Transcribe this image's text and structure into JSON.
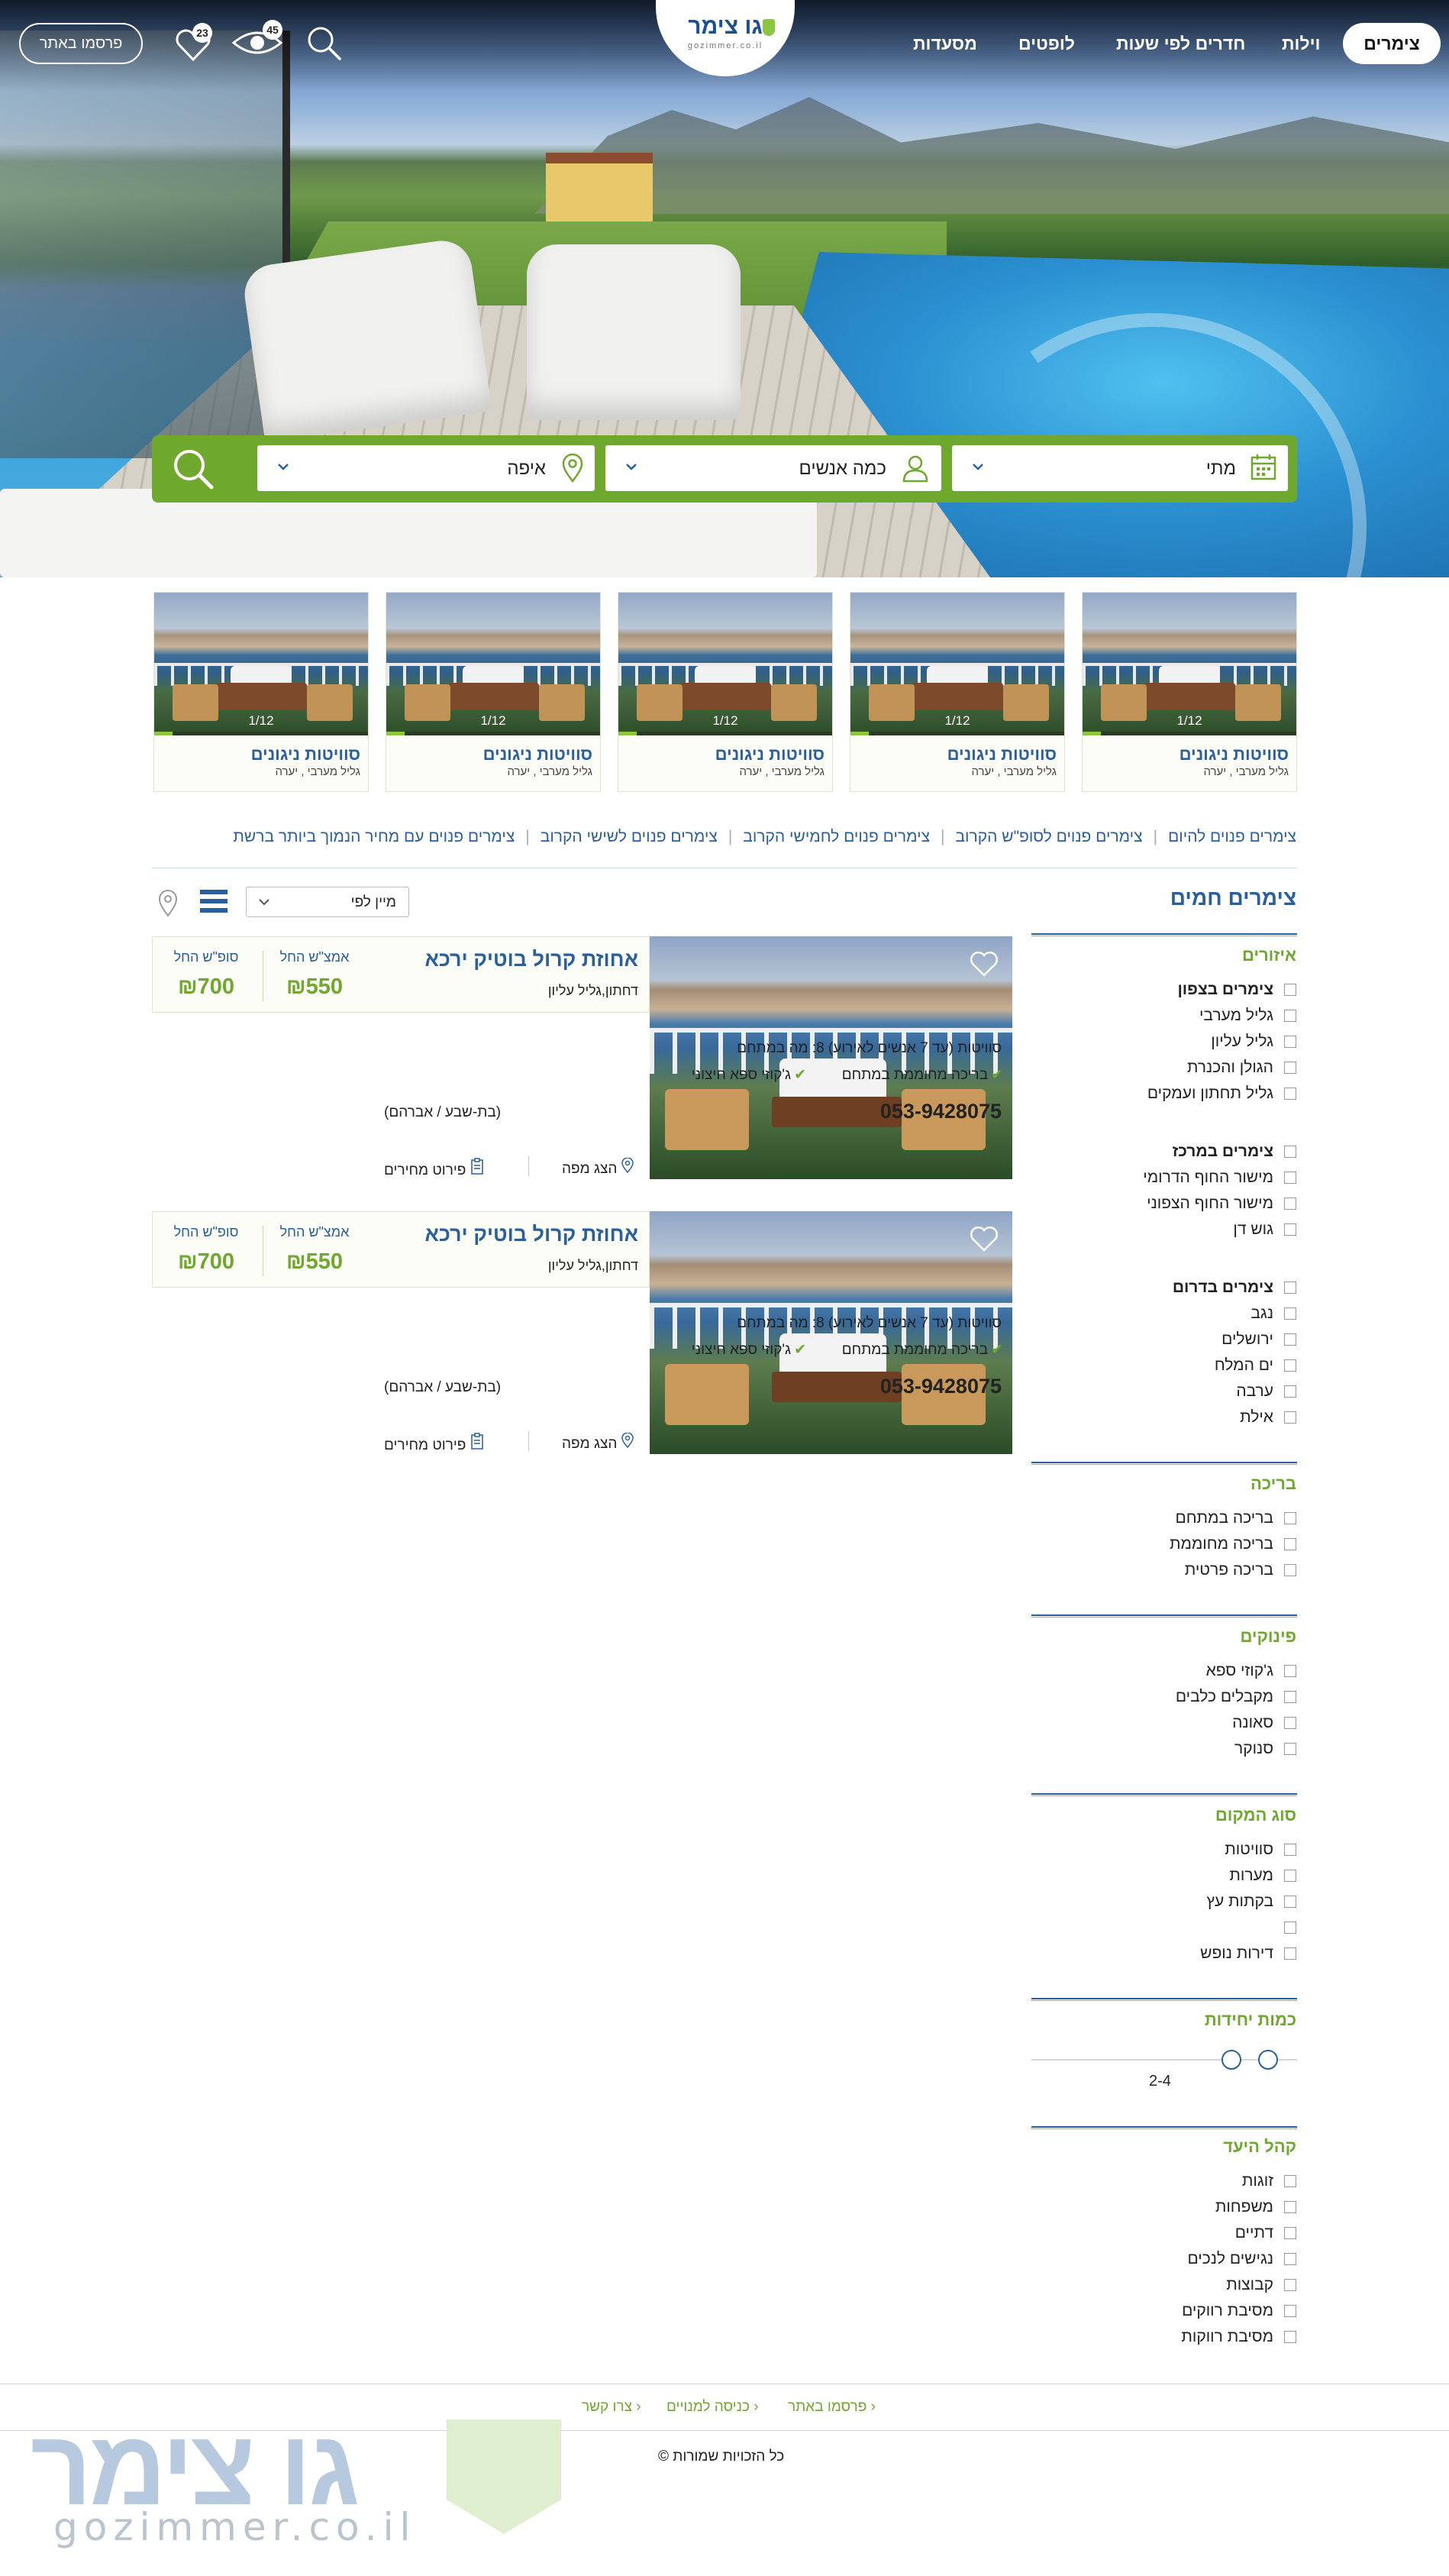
{
  "header": {
    "nav": [
      "צימרים",
      "וילות",
      "חדרים לפי שעות",
      "לופטים",
      "מסעדות"
    ],
    "logo_text": "גו צימר",
    "logo_sub": "gozimmer.co.il",
    "publish": "פרסמו באתר",
    "views_count": "45",
    "favorites_count": "23"
  },
  "search": {
    "when": "מתי",
    "people": "כמה אנשים",
    "where": "איפה"
  },
  "cards": [
    {
      "title": "סוויטות ניגונים",
      "sub": "גליל מערבי , יערה",
      "pager": "1/12"
    },
    {
      "title": "סוויטות ניגונים",
      "sub": "גליל מערבי , יערה",
      "pager": "1/12"
    },
    {
      "title": "סוויטות ניגונים",
      "sub": "גליל מערבי , יערה",
      "pager": "1/12"
    },
    {
      "title": "סוויטות ניגונים",
      "sub": "גליל מערבי , יערה",
      "pager": "1/12"
    },
    {
      "title": "סוויטות ניגונים",
      "sub": "גליל מערבי , יערה",
      "pager": "1/12"
    }
  ],
  "quick_links": [
    "צימרים פנוים להיום",
    "צימרים פנוים לסופ\"ש הקרוב",
    "צימרים פנוים לחמישי הקרוב",
    "צימרים פנוים לשישי הקרוב",
    "צימרים פנוים עם מחיר הנמוך ביותר ברשת"
  ],
  "sidebar": {
    "title": "צימרים חמים",
    "areas_head": "איזורים",
    "north": [
      "צימרים בצפון",
      "גליל מערבי",
      "גליל עליון",
      "הגולן והכנרת",
      "גליל תחתון ועמקים"
    ],
    "center": [
      "צימרים במרכז",
      "מישור החוף הדרומי",
      "מישור החוף הצפוני",
      "גוש דן"
    ],
    "south": [
      "צימרים בדרום",
      "נגב",
      "ירושלים",
      "ים המלח",
      "ערבה",
      "אילת"
    ],
    "pool_head": "בריכה",
    "pool": [
      "בריכה במתחם",
      "בריכה מחוממת",
      "בריכה פרטית"
    ],
    "pamper_head": "פינוקים",
    "pamper": [
      "ג'קוזי ספא",
      "מקבלים כלבים",
      "סאונה",
      "סנוקר"
    ],
    "type_head": "סוג המקום",
    "type": [
      "סוויטות",
      "מערות",
      "בקתות עץ",
      "",
      "דירות נופש"
    ],
    "units_head": "כמות יחידות",
    "units_range": "2-4",
    "audience_head": "קהל היעד",
    "audience": [
      "זוגות",
      "משפחות",
      "דתיים",
      "נגישים לנכים",
      "קבוצות",
      "מסיבת רווקים",
      "מסיבת רווקות"
    ]
  },
  "sort": {
    "label": "מיין לפי"
  },
  "listings": [
    {
      "name": "אחוזת קרול בוטיק ירכא",
      "location": "דחתון,גליל עליון",
      "midweek_label": "אמצ\"ש החל",
      "midweek_price": "₪550",
      "weekend_label": "סופ\"ש החל",
      "weekend_price": "₪700",
      "desc": "סוויטות (עד 7 אנשים לאירוע) 8: מה במתחם",
      "feat1": "בריכה מחוממת במתחם",
      "feat2": "ג'קוזי ספא חיצוני",
      "phone": "053-9428075",
      "contact": "(בת-שבע / אברהם)",
      "map": "הצג מפה",
      "prices": "פירוט מחירים"
    },
    {
      "name": "אחוזת קרול בוטיק ירכא",
      "location": "דחתון,גליל עליון",
      "midweek_label": "אמצ\"ש החל",
      "midweek_price": "₪550",
      "weekend_label": "סופ\"ש החל",
      "weekend_price": "₪700",
      "desc": "סוויטות (עד 7 אנשים לאירוע) 8: מה במתחם",
      "feat1": "בריכה מחוממת במתחם",
      "feat2": "ג'קוזי ספא חיצוני",
      "phone": "053-9428075",
      "contact": "(בת-שבע / אברהם)",
      "map": "הצג מפה",
      "prices": "פירוט מחירים"
    }
  ],
  "footer": {
    "links": [
      "פרסמו באתר",
      "כניסה למנויים",
      "צרו קשר"
    ],
    "copyright": "כל הזכויות שמורות ©",
    "logo_big": "גו צימר",
    "logo_url": "gozimmer.co.il"
  },
  "colors": {
    "brand_green": "#6ea82c",
    "brand_blue": "#2a5f9e"
  }
}
